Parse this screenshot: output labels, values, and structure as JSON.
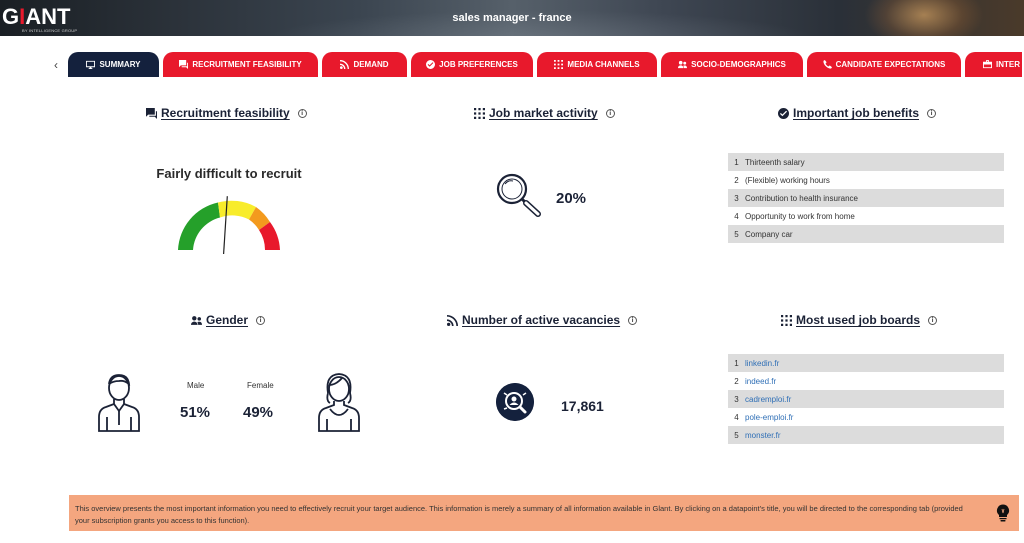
{
  "header": {
    "logo_main": "GIANT",
    "logo_sub": "BY INTELLIGENCE GROUP",
    "title": "sales manager - france"
  },
  "tabs": [
    {
      "label": "SUMMARY",
      "icon": "monitor-icon",
      "active": true
    },
    {
      "label": "RECRUITMENT FEASIBILITY",
      "icon": "chat-icon",
      "active": false
    },
    {
      "label": "DEMAND",
      "icon": "rss-icon",
      "active": false
    },
    {
      "label": "JOB PREFERENCES",
      "icon": "check-circle-icon",
      "active": false
    },
    {
      "label": "MEDIA CHANNELS",
      "icon": "grid-icon",
      "active": false
    },
    {
      "label": "SOCIO-DEMOGRAPHICS",
      "icon": "people-icon",
      "active": false
    },
    {
      "label": "CANDIDATE EXPECTATIONS",
      "icon": "phone-icon",
      "active": false
    },
    {
      "label": "INTER",
      "icon": "briefcase-icon",
      "active": false
    }
  ],
  "recruitment": {
    "title": "Recruitment feasibility",
    "status": "Fairly difficult to recruit",
    "gauge_level": 0.43
  },
  "market": {
    "title": "Job market activity",
    "value": "20%"
  },
  "benefits": {
    "title": "Important job benefits",
    "items": [
      {
        "rank": "1",
        "label": "Thirteenth salary"
      },
      {
        "rank": "2",
        "label": "(Flexible) working hours"
      },
      {
        "rank": "3",
        "label": "Contribution to health insurance"
      },
      {
        "rank": "4",
        "label": "Opportunity to work from home"
      },
      {
        "rank": "5",
        "label": "Company car"
      }
    ]
  },
  "gender": {
    "title": "Gender",
    "male_label": "Male",
    "male_value": "51%",
    "female_label": "Female",
    "female_value": "49%"
  },
  "vacancies": {
    "title": "Number of active vacancies",
    "value": "17,861"
  },
  "jobboards": {
    "title": "Most used job boards",
    "items": [
      {
        "rank": "1",
        "label": "linkedin.fr"
      },
      {
        "rank": "2",
        "label": "indeed.fr"
      },
      {
        "rank": "3",
        "label": "cadremploi.fr"
      },
      {
        "rank": "4",
        "label": "pole-emploi.fr"
      },
      {
        "rank": "5",
        "label": "monster.fr"
      }
    ]
  },
  "footer": {
    "text": "This overview presents the most important information you need to effectively recruit your target audience. This information is merely a summary of all information available in Glant. By clicking on a datapoint's title, you will be directed to the corresponding tab (provided your subscription grants you access to this function)."
  },
  "colors": {
    "brand_red": "#e8192c",
    "navy": "#14213d",
    "footer_bg": "#f4a67f"
  }
}
